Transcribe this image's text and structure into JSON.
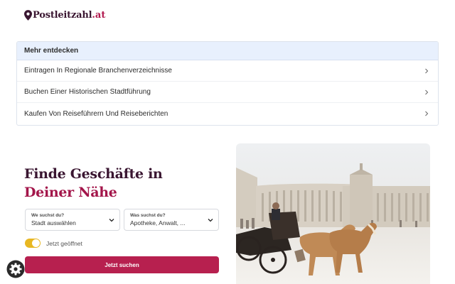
{
  "logo": {
    "name": "Postleitzahl",
    "tld": ".at"
  },
  "discover": {
    "header": "Mehr entdecken",
    "items": [
      {
        "label": "Eintragen In Regionale Branchenverzeichnisse"
      },
      {
        "label": "Buchen Einer Historischen Stadtführung"
      },
      {
        "label": "Kaufen Von Reiseführern Und Reiseberichten"
      }
    ]
  },
  "hero": {
    "title_line1": "Finde Geschäfte in",
    "title_line2": "Deiner Nähe"
  },
  "search": {
    "what_label": "We suchst du?",
    "what_value": "Stadt auswählen",
    "where_label": "Was suchst du?",
    "where_value": "Apotheke, Anwalt, ...",
    "toggle_label": "Jetzt geöffnet",
    "toggle_on": true,
    "submit_label": "Jetzt suchen"
  },
  "colors": {
    "brand_dark": "#3a1631",
    "brand_accent": "#b7204f",
    "toggle": "#e8b722",
    "panel_header": "#e8f0fd"
  },
  "icons": {
    "logo": "map-pin-icon",
    "row": "chevron-right-icon",
    "select": "chevron-down-icon",
    "settings": "gear-icon"
  }
}
